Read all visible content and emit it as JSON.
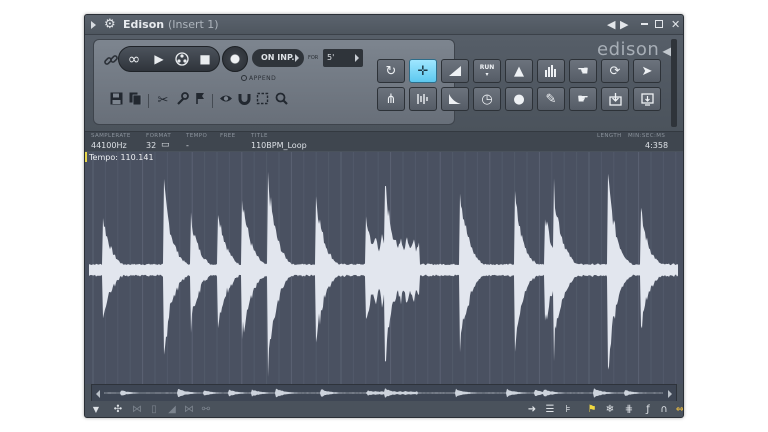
{
  "window": {
    "title": "Edison",
    "subtitle": "(Insert 1)"
  },
  "toolbar": {
    "on_input_label": "ON INP..",
    "for_label": "FOR",
    "for_value": "5'",
    "append_label": "APPEND",
    "logo_text": "edison"
  },
  "info": {
    "samplerate_label": "SAMPLERATE",
    "samplerate_value": "44100Hz",
    "format_label": "FORMAT",
    "format_value": "32",
    "tempo_label": "TEMPO",
    "tempo_value": "-",
    "free_label": "FREE",
    "title_label": "TITLE",
    "title_value": "110BPM_Loop",
    "length_label": "LENGTH",
    "length_unit_label": "MIN:SEC:MS",
    "length_value": "4:358"
  },
  "wave": {
    "tempo_text": "Tempo: 110.141"
  },
  "colors": {
    "accent": "#5cc8ef",
    "waveform": "#e2e6ee",
    "wave_bg": "#4a5161",
    "tempo_marker": "#e8d64a"
  }
}
